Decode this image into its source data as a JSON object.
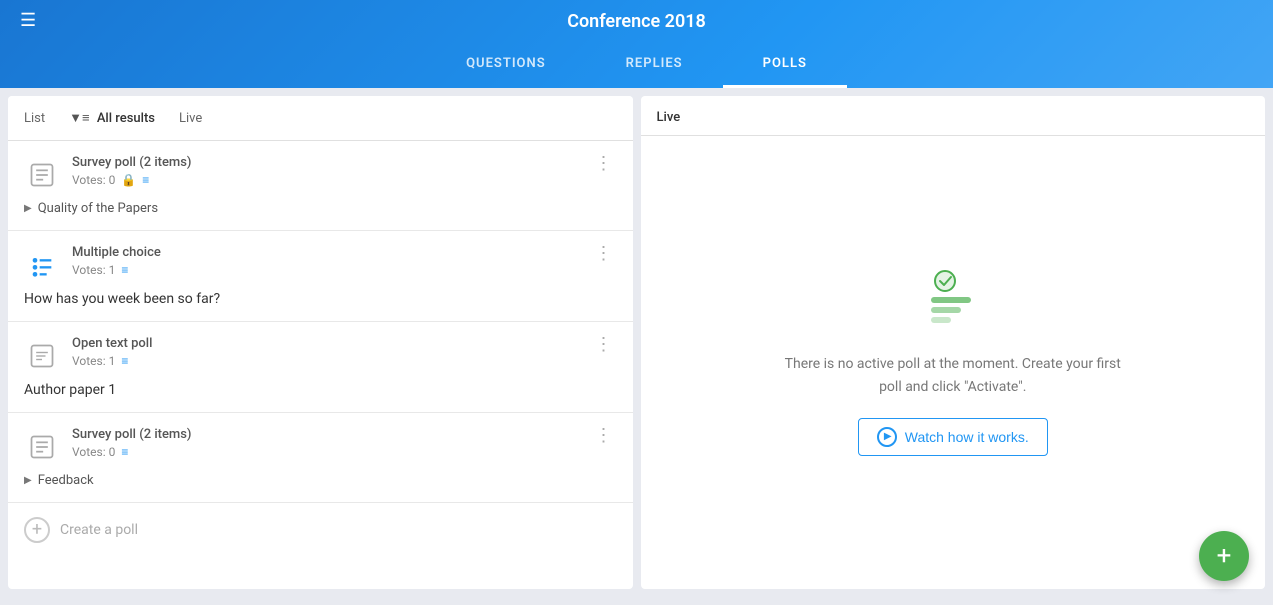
{
  "header": {
    "title": "Conference 2018",
    "hamburger": "☰",
    "tabs": [
      {
        "label": "QUESTIONS",
        "active": false
      },
      {
        "label": "REPLIES",
        "active": false
      },
      {
        "label": "POLLS",
        "active": true
      }
    ]
  },
  "left_panel": {
    "header_items": [
      {
        "label": "List",
        "active": false
      },
      {
        "label": "All results",
        "active": true
      },
      {
        "label": "Live",
        "active": false
      }
    ],
    "polls": [
      {
        "type": "Survey poll (2 items)",
        "votes": "Votes: 0",
        "has_lock": true,
        "has_filter": true,
        "subtitle": "Quality of the Papers",
        "has_arrow": true,
        "question": null,
        "icon_type": "survey"
      },
      {
        "type": "Multiple choice",
        "votes": "Votes: 1",
        "has_lock": false,
        "has_filter": true,
        "subtitle": null,
        "has_arrow": false,
        "question": "How has you week been so far?",
        "icon_type": "multiple"
      },
      {
        "type": "Open text poll",
        "votes": "Votes: 1",
        "has_lock": false,
        "has_filter": true,
        "subtitle": null,
        "has_arrow": false,
        "question": "Author paper 1",
        "icon_type": "open"
      },
      {
        "type": "Survey poll (2 items)",
        "votes": "Votes: 0",
        "has_lock": false,
        "has_filter": true,
        "subtitle": "Feedback",
        "has_arrow": true,
        "question": null,
        "icon_type": "survey"
      }
    ],
    "create_poll_label": "Create a poll"
  },
  "right_panel": {
    "header_label": "Live",
    "no_poll_message": "There is no active poll at the moment. Create your first poll and click \"Activate\".",
    "watch_btn_label": "Watch how it works.",
    "accent_color": "#2196f3",
    "green_color": "#4caf50"
  },
  "fab": {
    "label": "+",
    "color": "#4caf50"
  }
}
